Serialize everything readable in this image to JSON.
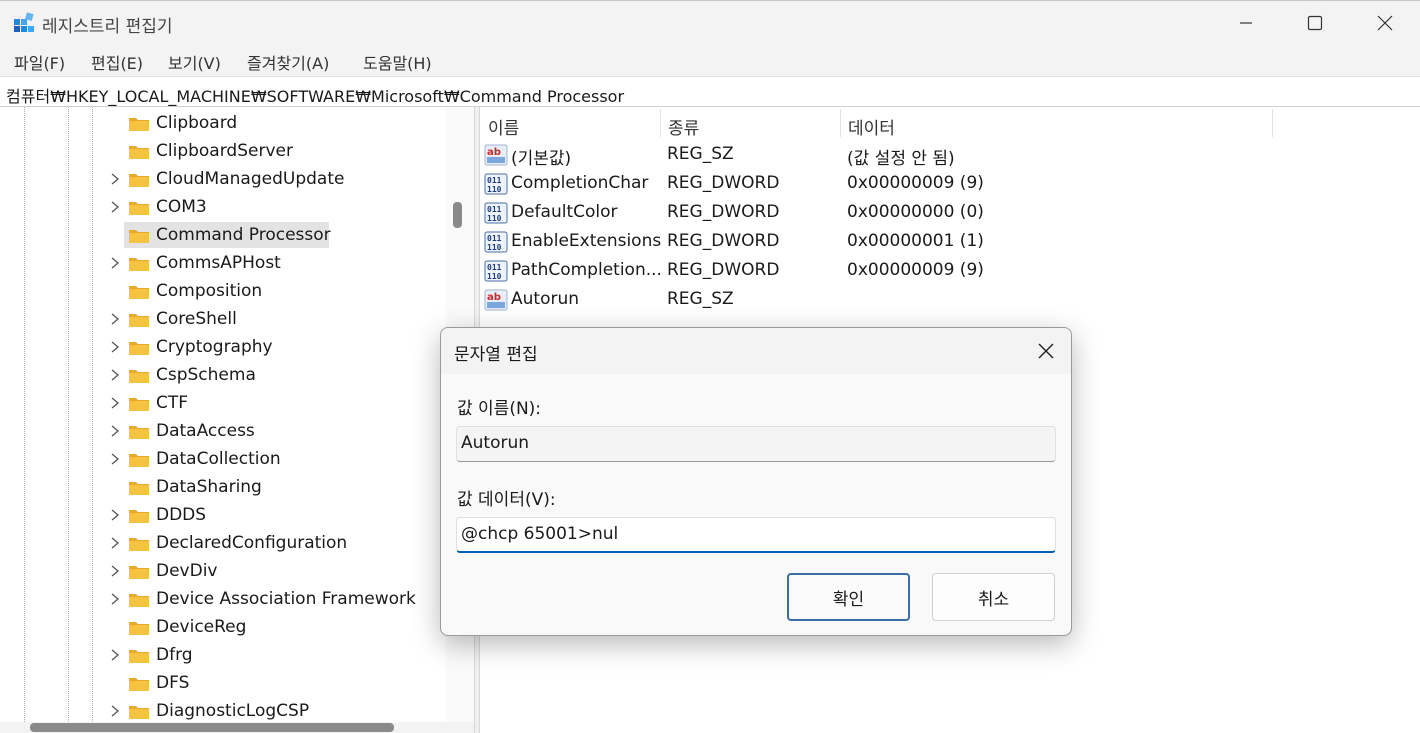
{
  "window": {
    "title": "레지스트리 편집기"
  },
  "menu": [
    "파일(F)",
    "편집(E)",
    "보기(V)",
    "즐겨찾기(A)",
    "도움말(H)"
  ],
  "address": "컴퓨터₩HKEY_LOCAL_MACHINE₩SOFTWARE₩Microsoft₩Command Processor",
  "tree": {
    "items": [
      {
        "label": "Clipboard",
        "expandable": false,
        "selected": false
      },
      {
        "label": "ClipboardServer",
        "expandable": false,
        "selected": false
      },
      {
        "label": "CloudManagedUpdate",
        "expandable": true,
        "selected": false
      },
      {
        "label": "COM3",
        "expandable": true,
        "selected": false
      },
      {
        "label": "Command Processor",
        "expandable": false,
        "selected": true
      },
      {
        "label": "CommsAPHost",
        "expandable": true,
        "selected": false
      },
      {
        "label": "Composition",
        "expandable": false,
        "selected": false
      },
      {
        "label": "CoreShell",
        "expandable": true,
        "selected": false
      },
      {
        "label": "Cryptography",
        "expandable": true,
        "selected": false
      },
      {
        "label": "CspSchema",
        "expandable": true,
        "selected": false
      },
      {
        "label": "CTF",
        "expandable": true,
        "selected": false
      },
      {
        "label": "DataAccess",
        "expandable": true,
        "selected": false
      },
      {
        "label": "DataCollection",
        "expandable": true,
        "selected": false
      },
      {
        "label": "DataSharing",
        "expandable": false,
        "selected": false
      },
      {
        "label": "DDDS",
        "expandable": true,
        "selected": false
      },
      {
        "label": "DeclaredConfiguration",
        "expandable": true,
        "selected": false
      },
      {
        "label": "DevDiv",
        "expandable": true,
        "selected": false
      },
      {
        "label": "Device Association Framework",
        "expandable": true,
        "selected": false
      },
      {
        "label": "DeviceReg",
        "expandable": false,
        "selected": false
      },
      {
        "label": "Dfrg",
        "expandable": true,
        "selected": false
      },
      {
        "label": "DFS",
        "expandable": false,
        "selected": false
      },
      {
        "label": "DiagnosticLogCSP",
        "expandable": true,
        "selected": false
      }
    ]
  },
  "values": {
    "columns": [
      "이름",
      "종류",
      "데이터"
    ],
    "rows": [
      {
        "icon": "string-value-icon",
        "name": "(기본값)",
        "type": "REG_SZ",
        "data": "(값 설정 안 됨)"
      },
      {
        "icon": "dword-value-icon",
        "name": "CompletionChar",
        "type": "REG_DWORD",
        "data": "0x00000009 (9)"
      },
      {
        "icon": "dword-value-icon",
        "name": "DefaultColor",
        "type": "REG_DWORD",
        "data": "0x00000000 (0)"
      },
      {
        "icon": "dword-value-icon",
        "name": "EnableExtensions",
        "type": "REG_DWORD",
        "data": "0x00000001 (1)"
      },
      {
        "icon": "dword-value-icon",
        "name": "PathCompletion...",
        "type": "REG_DWORD",
        "data": "0x00000009 (9)"
      },
      {
        "icon": "string-value-icon",
        "name": "Autorun",
        "type": "REG_SZ",
        "data": ""
      }
    ]
  },
  "dialog": {
    "title": "문자열 편집",
    "name_label": "값 이름(N):",
    "name_value": "Autorun",
    "data_label": "값 데이터(V):",
    "data_value": "@chcp 65001>nul",
    "ok_label": "확인",
    "cancel_label": "취소"
  },
  "colors": {
    "accent": "#005fb8",
    "folder": "#f5c342",
    "selection": "#e3e3e3"
  }
}
